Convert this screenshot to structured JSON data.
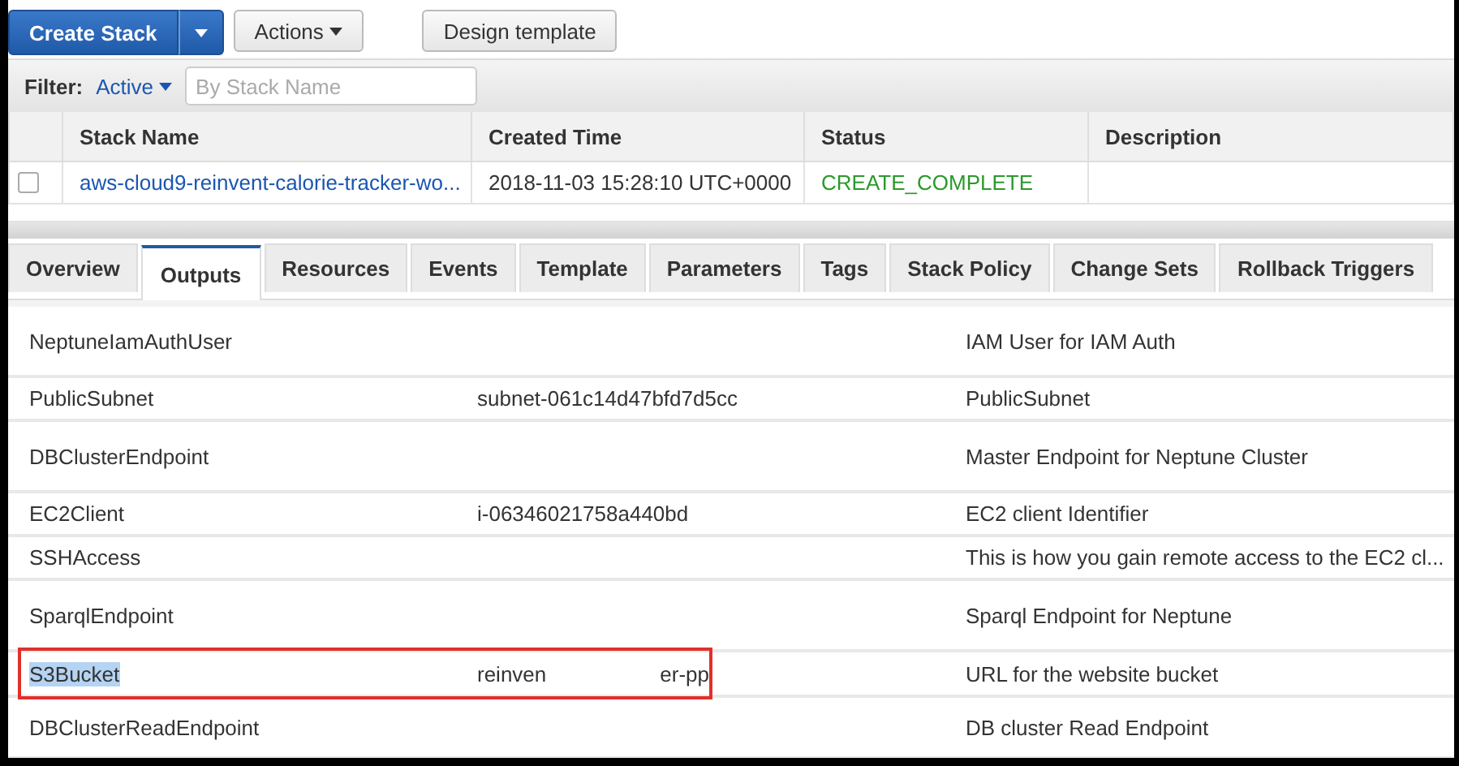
{
  "toolbar": {
    "buttons": [
      {
        "label": "Create Stack",
        "kind": "split-primary"
      },
      {
        "label": "Actions",
        "kind": "dropdown"
      },
      {
        "label": "Design template",
        "kind": "plain"
      }
    ]
  },
  "filter": {
    "label": "Filter:",
    "value": "Active",
    "placeholder": "By Stack Name"
  },
  "stacks": {
    "columns": [
      "Stack Name",
      "Created Time",
      "Status",
      "Description"
    ],
    "rows": [
      {
        "checked": false,
        "name": "aws-cloud9-reinvent-calorie-tracker-wo...",
        "created": "2018-11-03 15:28:10 UTC+0000",
        "status": "CREATE_COMPLETE",
        "description": ""
      }
    ]
  },
  "tabs": [
    {
      "label": "Overview",
      "selected": false
    },
    {
      "label": "Outputs",
      "selected": true
    },
    {
      "label": "Resources",
      "selected": false
    },
    {
      "label": "Events",
      "selected": false
    },
    {
      "label": "Template",
      "selected": false
    },
    {
      "label": "Parameters",
      "selected": false
    },
    {
      "label": "Tags",
      "selected": false
    },
    {
      "label": "Stack Policy",
      "selected": false
    },
    {
      "label": "Change Sets",
      "selected": false
    },
    {
      "label": "Rollback Triggers",
      "selected": false
    }
  ],
  "outputs": [
    {
      "key": "NeptuneIamAuthUser",
      "description": "IAM User for IAM Auth",
      "highlighted": false,
      "annotated": false
    },
    {
      "key": "PublicSubnet",
      "value": [
        "subnet-061c14d47bfd7d5cc"
      ],
      "description": "PublicSubnet",
      "highlighted": false,
      "annotated": false
    },
    {
      "key": "DBClusterEndpoint",
      "description": "Master Endpoint for Neptune Cluster",
      "highlighted": false,
      "annotated": false
    },
    {
      "key": "EC2Client",
      "value": [
        "i-06346021758a440bd"
      ],
      "description": "EC2 client Identifier",
      "highlighted": false,
      "annotated": false
    },
    {
      "key": "SSHAccess",
      "description": "This is how you gain remote access to the EC2 cl...",
      "highlighted": false,
      "annotated": false
    },
    {
      "key": "SparqlEndpoint",
      "description": "Sparql Endpoint for Neptune",
      "highlighted": false,
      "annotated": false
    },
    {
      "key": "S3Bucket",
      "value": [
        "reinven",
        "er-pp"
      ],
      "description": "URL for the website bucket",
      "highlighted": true,
      "annotated": true
    },
    {
      "key": "DBClusterReadEndpoint",
      "description": "DB cluster Read Endpoint",
      "highlighted": false,
      "annotated": false
    }
  ]
}
